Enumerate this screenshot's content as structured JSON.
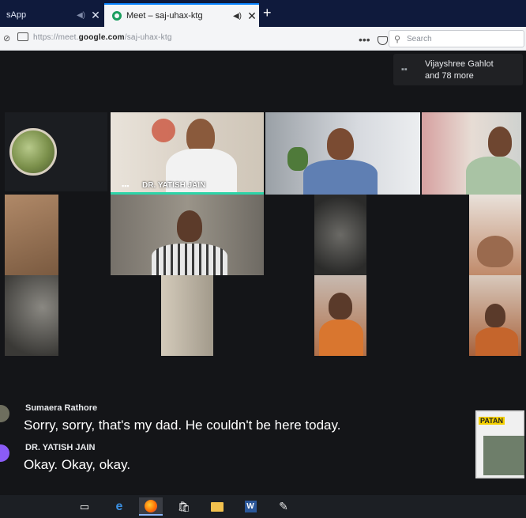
{
  "browser": {
    "tabs": [
      {
        "title": "sApp",
        "close": "✕"
      },
      {
        "title": "Meet – saj-uhax-ktg",
        "close": "✕"
      }
    ],
    "new_tab": "+",
    "url_prefix": "https://meet.",
    "url_domain": "google.com",
    "url_path": "/saj-uhax-ktg",
    "search_placeholder": "Search",
    "page_actions": "•••"
  },
  "meet": {
    "participants_text_line1": "Vijayshree Gahlot",
    "participants_text_line2": "and 78 more",
    "active_speaker_label": "DR. YATISH JAIN"
  },
  "captions": [
    {
      "name": "Sumaera Rathore",
      "text": "Sorry, sorry, that's my dad. He couldn't be here today."
    },
    {
      "name": "DR. YATISH JAIN",
      "text": "Okay. Okay, okay."
    }
  ],
  "pip": {
    "title": "PATAN"
  },
  "taskbar": {
    "word_letter": "W"
  },
  "colors": {
    "tabbar": "#0f1a3c",
    "call_background": "#141518",
    "active_speaker_bar": "#2dd4a8",
    "meet_icon": "#1a9e5e"
  }
}
